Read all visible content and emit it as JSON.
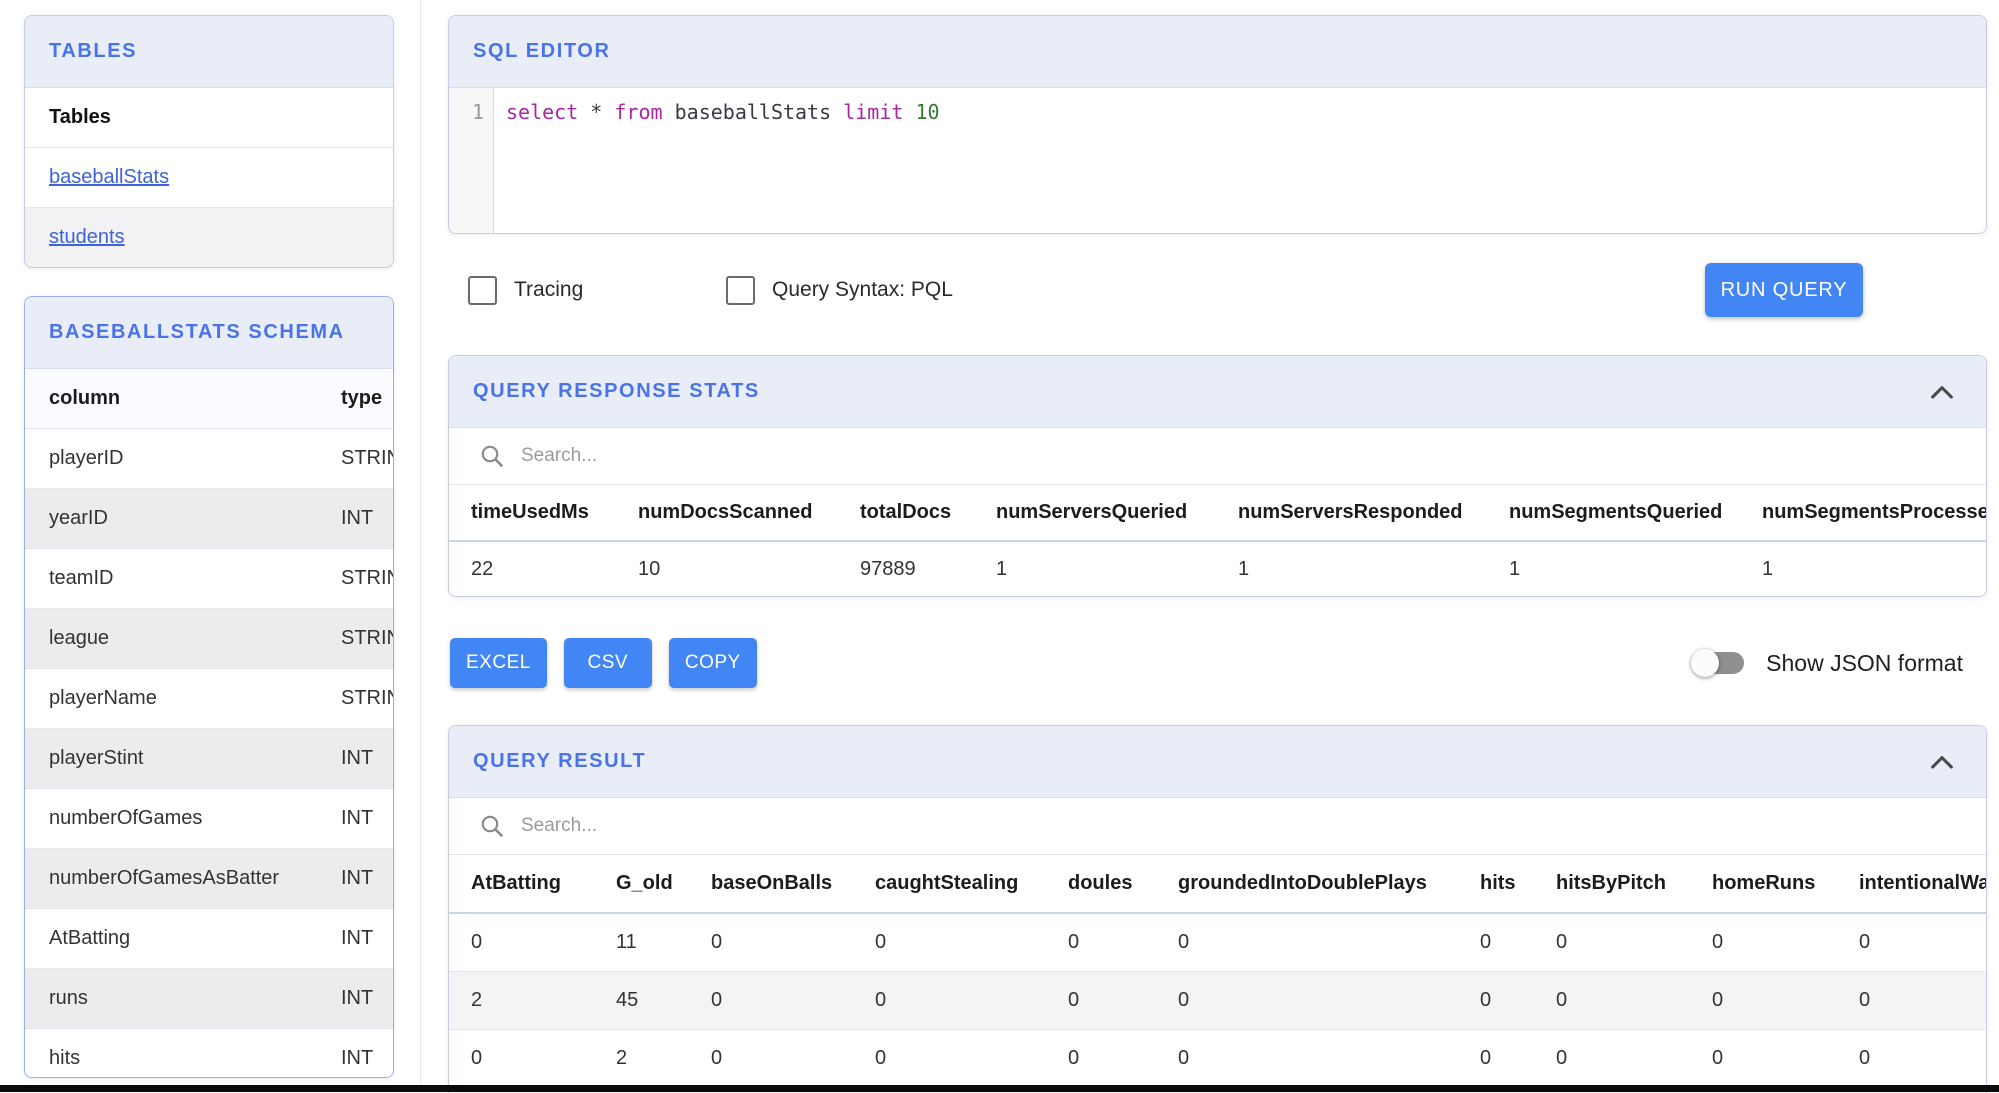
{
  "sidebar": {
    "tables_panel": {
      "title": "TABLES",
      "list_header": "Tables",
      "items": [
        "baseballStats",
        "students"
      ]
    },
    "schema_panel": {
      "title": "BASEBALLSTATS SCHEMA",
      "table": {
        "headers": [
          "column",
          "type"
        ],
        "rows": [
          [
            "playerID",
            "STRING"
          ],
          [
            "yearID",
            "INT"
          ],
          [
            "teamID",
            "STRING"
          ],
          [
            "league",
            "STRING"
          ],
          [
            "playerName",
            "STRING"
          ],
          [
            "playerStint",
            "INT"
          ],
          [
            "numberOfGames",
            "INT"
          ],
          [
            "numberOfGamesAsBatter",
            "INT"
          ],
          [
            "AtBatting",
            "INT"
          ],
          [
            "runs",
            "INT"
          ],
          [
            "hits",
            "INT"
          ]
        ]
      }
    }
  },
  "editor": {
    "title": "SQL EDITOR",
    "line_number": "1",
    "tokens": [
      {
        "text": "select",
        "type": "keyword"
      },
      {
        "text": "*",
        "type": "operator"
      },
      {
        "text": "from",
        "type": "keyword"
      },
      {
        "text": "baseballStats",
        "type": "identifier"
      },
      {
        "text": "limit",
        "type": "keyword"
      },
      {
        "text": "10",
        "type": "number"
      }
    ]
  },
  "controls": {
    "tracing_label": "Tracing",
    "pql_label": "Query Syntax: PQL",
    "run_button_label": "RUN QUERY"
  },
  "response_stats": {
    "title": "QUERY RESPONSE STATS",
    "search_placeholder": "Search...",
    "table": {
      "headers": [
        "timeUsedMs",
        "numDocsScanned",
        "totalDocs",
        "numServersQueried",
        "numServersResponded",
        "numSegmentsQueried",
        "numSegmentsProcessed"
      ],
      "rows": [
        [
          "22",
          "10",
          "97889",
          "1",
          "1",
          "1",
          "1"
        ]
      ]
    }
  },
  "export_bar": {
    "buttons": [
      "EXCEL",
      "CSV",
      "COPY"
    ],
    "toggle_label": "Show JSON format"
  },
  "query_result": {
    "title": "QUERY RESULT",
    "search_placeholder": "Search...",
    "table": {
      "headers": [
        "AtBatting",
        "G_old",
        "baseOnBalls",
        "caughtStealing",
        "doules",
        "groundedIntoDoublePlays",
        "hits",
        "hitsByPitch",
        "homeRuns",
        "intentionalWalks"
      ],
      "rows": [
        [
          "0",
          "11",
          "0",
          "0",
          "0",
          "0",
          "0",
          "0",
          "0",
          "0"
        ],
        [
          "2",
          "45",
          "0",
          "0",
          "0",
          "0",
          "0",
          "0",
          "0",
          "0"
        ],
        [
          "0",
          "2",
          "0",
          "0",
          "0",
          "0",
          "0",
          "0",
          "0",
          "0"
        ]
      ]
    }
  },
  "colors": {
    "accent_blue": "#4a73e8",
    "button_blue": "#4285f4",
    "panel_header_bg": "#e9edf8",
    "link_blue": "#3e63d8",
    "row_alt_gray": "#f4f4f5"
  }
}
